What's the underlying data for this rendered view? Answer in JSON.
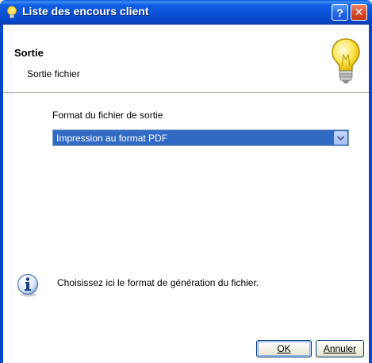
{
  "window": {
    "title": "Liste des encours client",
    "help_label": "?",
    "close_label": "✕"
  },
  "header": {
    "title": "Sortie",
    "subtitle": "Sortie fichier"
  },
  "form": {
    "format_label": "Format du fichier de sortie",
    "format_selected": "Impression au format PDF"
  },
  "info": {
    "message": "Choisissez ici le format de génération du fichier."
  },
  "buttons": {
    "ok_label": "OK",
    "cancel_label": "Annuler"
  },
  "colors": {
    "titlebar": "#0846c8",
    "selection": "#316ac5",
    "close": "#d8492a"
  },
  "icons": [
    "lightbulb-icon",
    "help-icon",
    "close-icon",
    "dropdown-arrow-icon",
    "info-icon"
  ]
}
